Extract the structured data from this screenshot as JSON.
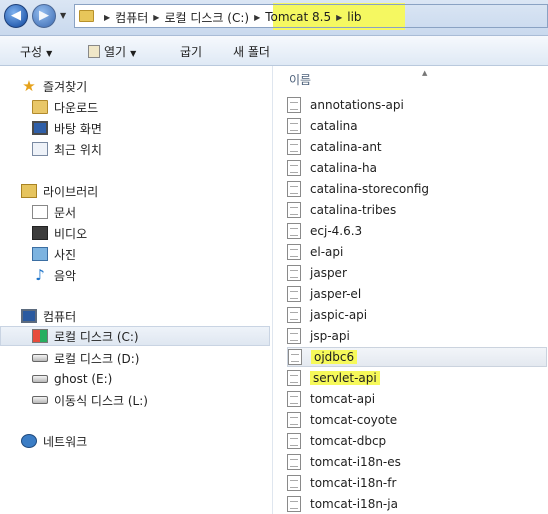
{
  "address": {
    "crumbs": [
      "컴퓨터",
      "로컬 디스크 (C:)",
      "Tomcat 8.5",
      "lib"
    ],
    "highlight_color": "#f5f861"
  },
  "toolbar": {
    "organize": "구성",
    "open": "열기",
    "share": "굽기",
    "new_folder": "새 폴더"
  },
  "nav": {
    "favorites": {
      "label": "즐겨찾기",
      "items": [
        "다운로드",
        "바탕 화면",
        "최근 위치"
      ]
    },
    "libraries": {
      "label": "라이브러리",
      "items": [
        "문서",
        "비디오",
        "사진",
        "음악"
      ]
    },
    "computer": {
      "label": "컴퓨터",
      "items": [
        "로컬 디스크 (C:)",
        "로컬 디스크 (D:)",
        "ghost (E:)",
        "이동식 디스크 (L:)"
      ]
    },
    "network": {
      "label": "네트워크"
    }
  },
  "files": {
    "column_name": "이름",
    "items": [
      "annotations-api",
      "catalina",
      "catalina-ant",
      "catalina-ha",
      "catalina-storeconfig",
      "catalina-tribes",
      "ecj-4.6.3",
      "el-api",
      "jasper",
      "jasper-el",
      "jaspic-api",
      "jsp-api",
      "ojdbc6",
      "servlet-api",
      "tomcat-api",
      "tomcat-coyote",
      "tomcat-dbcp",
      "tomcat-i18n-es",
      "tomcat-i18n-fr",
      "tomcat-i18n-ja"
    ]
  }
}
